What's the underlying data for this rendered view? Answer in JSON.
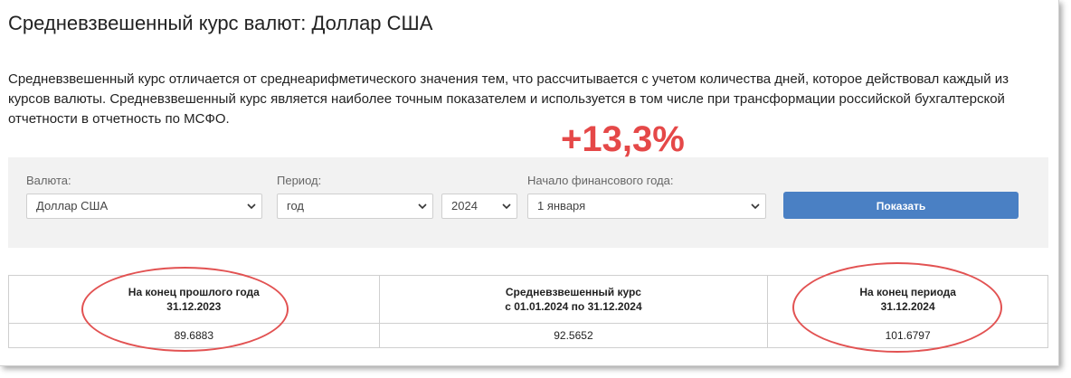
{
  "page": {
    "title": "Средневзвешенный курс валют: Доллар США",
    "description": "Средневзвешенный курс отличается от среднеарифметического значения тем, что рассчитывается с учетом количества дней, которое действовал каждый из курсов валюты. Средневзвешенный курс является наиболее точным показателем и используется в том числе при трансформации российской бухгалтерской отчетности в отчетность по МСФО.",
    "highlight": "+13,3%",
    "highlight_color": "#e54848"
  },
  "filters": {
    "currency_label": "Валюта:",
    "currency_value": "Доллар США",
    "period_label": "Период:",
    "period_value": "год",
    "year_value": "2024",
    "fy_label": "Начало финансового года:",
    "fy_value": "1 января",
    "show_button": "Показать",
    "button_color": "#4a80c4"
  },
  "table": {
    "headers": [
      {
        "line1": "На конец прошлого года",
        "line2": "31.12.2023"
      },
      {
        "line1": "Средневзвешенный курс",
        "line2": "с 01.01.2024 по 31.12.2024"
      },
      {
        "line1": "На конец периода",
        "line2": "31.12.2024"
      }
    ],
    "values": [
      "89.6883",
      "92.5652",
      "101.6797"
    ]
  },
  "annotation_color": "#e25252"
}
